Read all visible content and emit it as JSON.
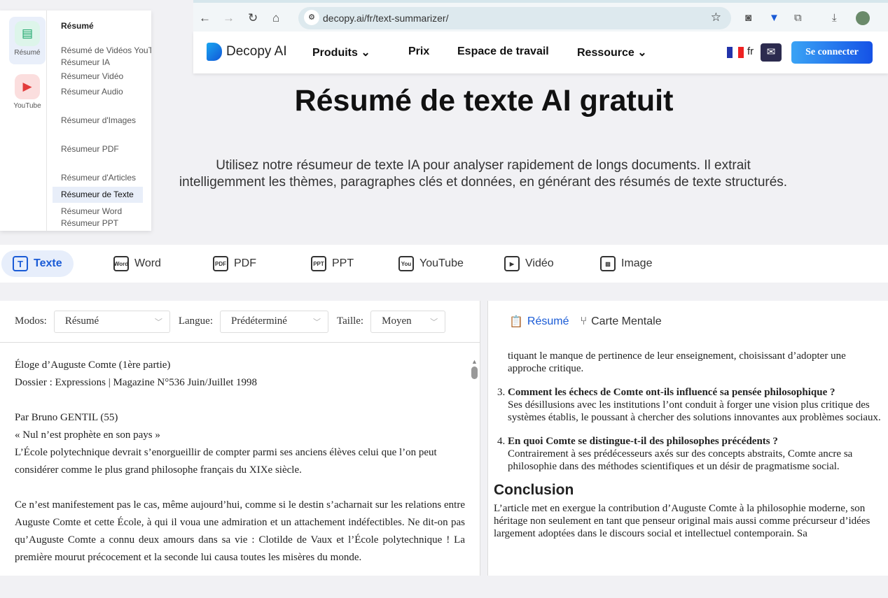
{
  "browser": {
    "url": "decopy.ai/fr/text-summarizer/"
  },
  "header": {
    "brand": "Decopy AI",
    "nav": [
      "Produits",
      "Prix",
      "Espace de travail",
      "Ressource"
    ],
    "lang": "fr",
    "login": "Se connecter"
  },
  "menu": {
    "rail": [
      "Résumé",
      "YouTube"
    ],
    "heading": "Résumé",
    "items": [
      "Résumé de Vidéos YouTube",
      "Résumeur IA",
      "Résumeur Vidéo",
      "Résumeur Audio",
      "Résumeur d'Images",
      "Résumeur PDF",
      "Résumeur d'Articles",
      "Résumeur de Texte",
      "Résumeur Word",
      "Résumeur PPT"
    ]
  },
  "hero": {
    "title": "Résumé de texte AI gratuit",
    "subtitle": "Utilisez notre résumeur de texte IA pour analyser rapidement de longs documents. Il extrait intelligemment les thèmes, paragraphes clés et données, en générant des résumés de texte structurés."
  },
  "tabs": [
    {
      "label": "Texte",
      "icon": "T"
    },
    {
      "label": "Word",
      "icon": "Word"
    },
    {
      "label": "PDF",
      "icon": "PDF"
    },
    {
      "label": "PPT",
      "icon": "PPT"
    },
    {
      "label": "YouTube",
      "icon": "You"
    },
    {
      "label": "Vidéo",
      "icon": "▶"
    },
    {
      "label": "Image",
      "icon": "▨"
    }
  ],
  "options": {
    "mode_label": "Modos:",
    "mode": "Résumé",
    "lang_label": "Langue:",
    "lang": "Prédéterminé",
    "size_label": "Taille:",
    "size": "Moyen"
  },
  "input_text": [
    "Éloge d’Auguste Comte (1ère partie)",
    "Dossier : Expressions | Magazine N°536 Juin/Juillet 1998",
    "Par Bruno GENTIL (55)",
    "« Nul n’est prophète en son pays »",
    "L’École polytechnique devrait s’enorgueillir de compter parmi ses anciens élèves celui que l’on peut considérer comme le plus grand philosophe français du XIXe siècle.",
    "Ce n’est manifestement pas le cas, même aujourd’hui, comme si le destin s’acharnait sur les relations entre Auguste Comte et cette École, à qui il voua une admiration et un attachement indéfectibles. Ne dit-on pas qu’Auguste Comte a connu deux amours dans sa vie : Clotilde de Vaux et l’École polytechnique ! La première mourut précocement et la seconde lui causa toutes les misères du monde."
  ],
  "result": {
    "tabs": [
      "Résumé",
      "Carte Mentale"
    ],
    "partial": "tiquant le manque de pertinence de leur enseignement, choisissant d’adopter une approche critique.",
    "items": [
      {
        "q": "Comment les échecs de Comte ont-ils influencé sa pensée philosophique ?",
        "a": "Ses désillusions avec les institutions l’ont conduit à forger une vision plus critique des systèmes établis, le poussant à chercher des solutions innovantes aux problèmes sociaux."
      },
      {
        "q": "En quoi Comte se distingue-t-il des philosophes précédents ?",
        "a": "Contrairement à ses prédécesseurs axés sur des concepts abstraits, Comte ancre sa philosophie dans des méthodes scientifiques et un désir de pragmatisme social."
      }
    ],
    "conclusion_title": "Conclusion",
    "conclusion": "L’article met en exergue la contribution d’Auguste Comte à la philosophie moderne, son héritage non seulement en tant que penseur original mais aussi comme précurseur d’idées largement adoptées dans le discours social et intellectuel contemporain. Sa"
  }
}
